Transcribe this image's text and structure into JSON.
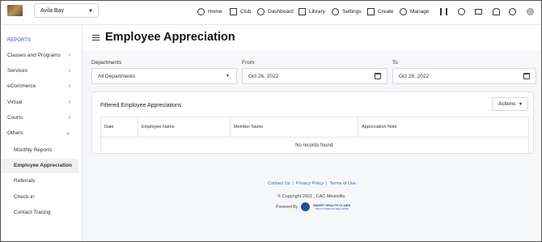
{
  "topbar": {
    "club_selector": "Avila Bay",
    "nav": [
      {
        "label": "Home",
        "icon": "home-icon"
      },
      {
        "label": "Club",
        "icon": "club-icon"
      },
      {
        "label": "Dashboard",
        "icon": "dashboard-icon"
      },
      {
        "label": "Library",
        "icon": "library-icon"
      },
      {
        "label": "Settings",
        "icon": "gear-icon"
      },
      {
        "label": "Create",
        "icon": "create-icon"
      },
      {
        "label": "Manage",
        "icon": "manage-icon"
      }
    ],
    "utility_icons": [
      "barcode-icon",
      "globe-icon",
      "mail-icon",
      "bell-icon",
      "help-icon",
      "user-icon"
    ]
  },
  "sidebar": {
    "heading": "REPORTS",
    "items": [
      {
        "label": "Classes and Programs"
      },
      {
        "label": "Services"
      },
      {
        "label": "eCommerce"
      },
      {
        "label": "Virtual"
      },
      {
        "label": "Courts"
      },
      {
        "label": "Others"
      }
    ],
    "subitems": [
      {
        "label": "Monthly Reports"
      },
      {
        "label": "Employee Appreciation"
      },
      {
        "label": "Referrals"
      },
      {
        "label": "Check-in"
      },
      {
        "label": "Contact Tracing"
      }
    ]
  },
  "page": {
    "title": "Employee Appreciation",
    "filters": {
      "departments_label": "Departments",
      "departments_value": "All Departments",
      "from_label": "From",
      "from_value": "Oct 26, 2022",
      "to_label": "To",
      "to_value": "Oct 26, 2022"
    },
    "card": {
      "title": "Filtered Employee Appreciations",
      "actions_label": "Actions",
      "columns": [
        "Date",
        "Employee Name",
        "Member Name",
        "Appreciation Note"
      ],
      "empty_text": "No records found."
    }
  },
  "footer": {
    "links": [
      "Contact Us",
      "Privacy Policy",
      "Terms of Use"
    ],
    "separator": "|",
    "copyright": "© Copyright 2022 , CAC Minimillio.",
    "powered_by": "Powered By",
    "brand_line1": "SMART HEALTH CLUBS",
    "brand_line2": "THE FUTURE OF WELLNESS"
  },
  "colors": {
    "accent": "#3b4fa0",
    "link": "#3b6bb0",
    "background": "#f6f7f9"
  }
}
